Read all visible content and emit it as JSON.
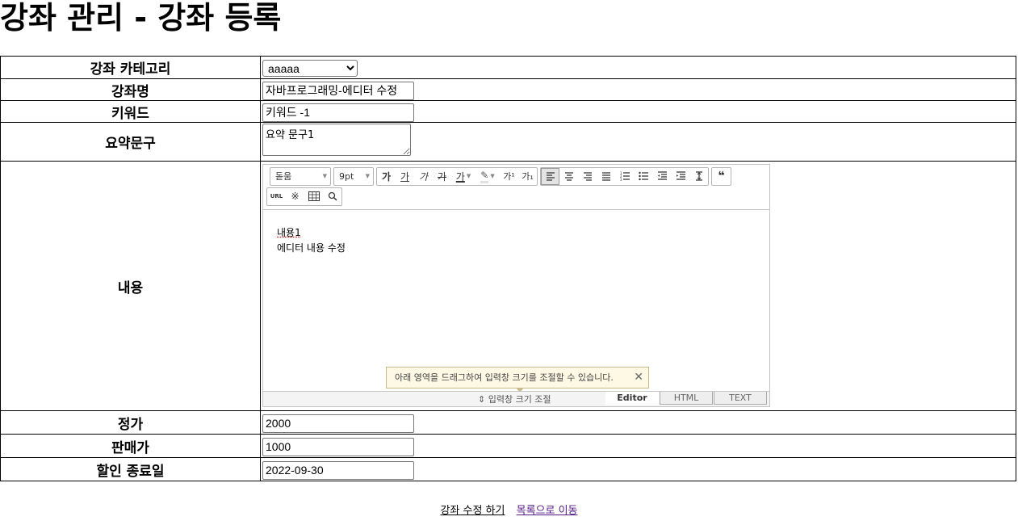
{
  "page_title": "강좌 관리 - 강좌 등록",
  "form": {
    "category": {
      "label": "강좌 카테고리",
      "selected": "aaaaa"
    },
    "name": {
      "label": "강좌명",
      "value": "자바프로그래밍-에디터 수정"
    },
    "keyword": {
      "label": "키워드",
      "value": "키워드 -1"
    },
    "summary": {
      "label": "요약문구",
      "value": "요약 문구1"
    },
    "content": {
      "label": "내용"
    },
    "price": {
      "label": "정가",
      "value": "2000"
    },
    "sale_price": {
      "label": "판매가",
      "value": "1000"
    },
    "discount_end": {
      "label": "할인 종료일",
      "value": "2022-09-30"
    }
  },
  "editor": {
    "font": "돋움",
    "size": "9pt",
    "format_buttons": [
      "가",
      "가",
      "가",
      "가",
      "가"
    ],
    "sup": "가¹",
    "sub": "가₁",
    "quote": "❝",
    "url_button": "URL",
    "lines": [
      "내용1",
      "에디터 내용 수정"
    ],
    "tip": "아래 영역을 드래그하여 입력창 크기를 조절할 수 있습니다.",
    "resize_label": "⇕ 입력창 크기 조절",
    "tabs": [
      "Editor",
      "HTML",
      "TEXT"
    ]
  },
  "links": {
    "submit": "강좌 수정 하기",
    "list": "목록으로 이동"
  }
}
